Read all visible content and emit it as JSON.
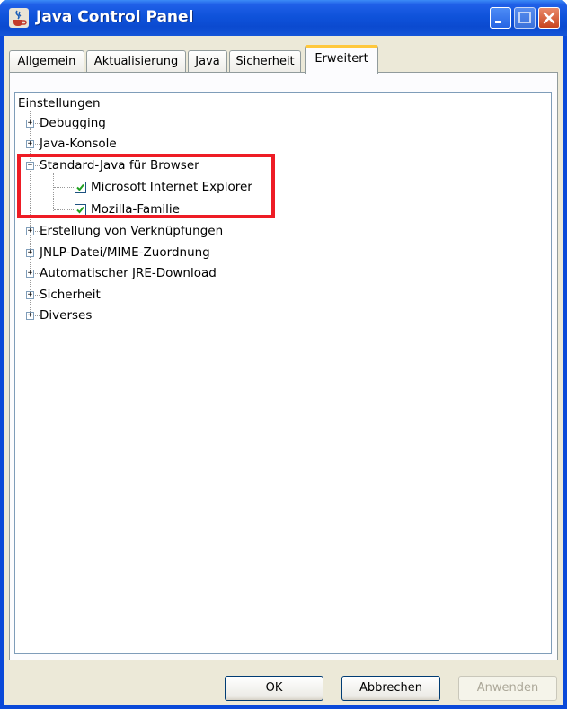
{
  "window": {
    "title": "Java Control Panel"
  },
  "tabs": [
    {
      "label": "Allgemein"
    },
    {
      "label": "Aktualisierung"
    },
    {
      "label": "Java"
    },
    {
      "label": "Sicherheit"
    },
    {
      "label": "Erweitert",
      "active": true
    }
  ],
  "tree": {
    "root": "Einstellungen",
    "items": [
      {
        "label": "Debugging",
        "expanded": false
      },
      {
        "label": "Java-Konsole",
        "expanded": false
      },
      {
        "label": "Standard-Java für Browser",
        "expanded": true,
        "children": [
          {
            "label": "Microsoft Internet Explorer",
            "checked": true
          },
          {
            "label": "Mozilla-Familie",
            "checked": true
          }
        ]
      },
      {
        "label": "Erstellung von Verknüpfungen",
        "expanded": false
      },
      {
        "label": "JNLP-Datei/MIME-Zuordnung",
        "expanded": false
      },
      {
        "label": "Automatischer JRE-Download",
        "expanded": false
      },
      {
        "label": "Sicherheit",
        "expanded": false
      },
      {
        "label": "Diverses",
        "expanded": false
      }
    ]
  },
  "buttons": {
    "ok": "OK",
    "cancel": "Abbrechen",
    "apply": "Anwenden"
  },
  "colors": {
    "titlebar": "#0b4ad0",
    "highlight": "#ee1c25",
    "checkmark": "#21a121"
  }
}
